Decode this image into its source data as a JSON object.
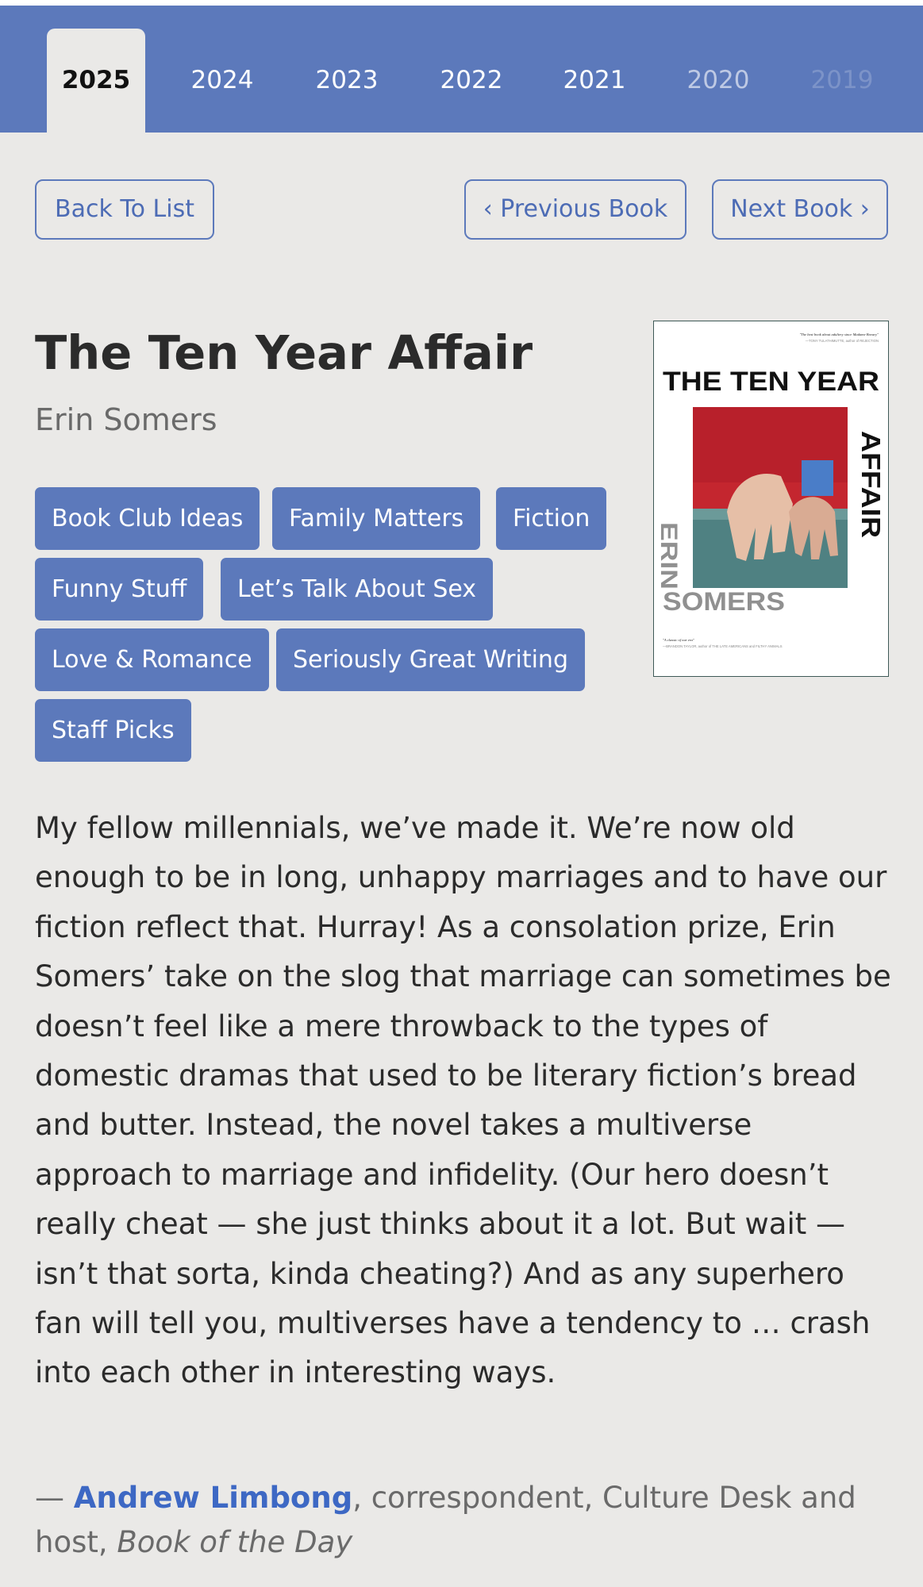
{
  "years": {
    "tabs": [
      "2025",
      "2024",
      "2023",
      "2022",
      "2021",
      "2020",
      "2019"
    ],
    "active": "2025"
  },
  "nav": {
    "back": "Back To List",
    "previous": "‹ Previous Book",
    "next": "Next Book ›"
  },
  "book": {
    "title": "The Ten Year Affair",
    "author": "Erin Somers",
    "tags": [
      "Book Club Ideas",
      "Family Matters",
      "Fiction",
      "Funny Stuff",
      "Let’s Talk About Sex",
      "Love & Romance",
      "Seriously Great Writing",
      "Staff Picks"
    ],
    "cover": {
      "title_line1": "THE TEN YEAR",
      "title_line2": "AFFAIR",
      "author_first": "ERIN",
      "author_last": "SOMERS",
      "top_blurb": "\"The best book about adultery since Madame Bovary\"",
      "top_blurb_credit": "—TONY TULATHIMUTTE, author of REJECTION",
      "bottom_blurb": "\"A classic of our era\"",
      "bottom_blurb_credit": "—BRANDON TAYLOR, author of THE LATE AMERICANS and FILTHY ANIMALS"
    }
  },
  "review": {
    "text": "My fellow millennials, we’ve made it. We’re now old enough to be in long, unhappy marriages and to have our fiction reflect that. Hurray! As a consolation prize, Erin Somers’ take on the slog that marriage can sometimes be doesn’t feel like a mere throwback to the types of domestic dramas that used to be literary fiction’s bread and butter. Instead, the novel takes a multiverse approach to marriage and infidelity. (Our hero doesn’t really cheat — she just thinks about it a lot. But wait — isn’t that sorta, kinda cheating?) And as any superhero fan will tell you, multiverses have a tendency to … crash into each other in interesting ways.",
    "credit_prefix": "— ",
    "reviewer": "Andrew Limbong",
    "credit_role": ", correspondent, Culture Desk and host, ",
    "credit_show": "Book of the Day"
  },
  "colors": {
    "accent": "#5c79bb",
    "background": "#eae9e7",
    "link": "#3d68c4"
  }
}
